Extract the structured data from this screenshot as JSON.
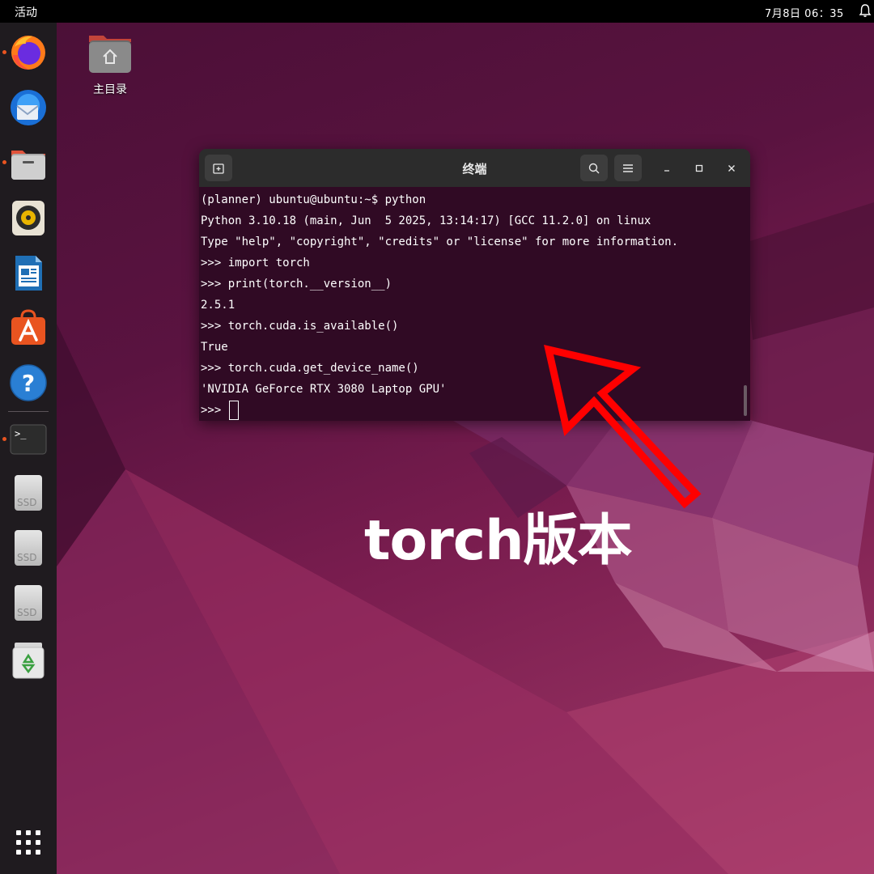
{
  "topbar": {
    "activities": "活动",
    "clock": "7月8日  06：35",
    "notification_icon": "bell-icon"
  },
  "dock": {
    "items": [
      {
        "name": "firefox",
        "icon": "firefox-icon",
        "running": true
      },
      {
        "name": "thunderbird",
        "icon": "thunderbird-icon",
        "running": false
      },
      {
        "name": "files",
        "icon": "files-icon",
        "running": true
      },
      {
        "name": "rhythmbox",
        "icon": "rhythmbox-icon",
        "running": false
      },
      {
        "name": "libreoffice-writer",
        "icon": "writer-icon",
        "running": false
      },
      {
        "name": "app-center",
        "icon": "app-center-icon",
        "running": false
      },
      {
        "name": "help",
        "icon": "help-icon",
        "running": false
      },
      {
        "name": "terminal",
        "icon": "terminal-icon",
        "running": true
      }
    ],
    "drives": [
      "SSD",
      "SSD",
      "SSD"
    ],
    "trash_icon": "trash-icon",
    "show_apps_icon": "app-grid-icon"
  },
  "desktop": {
    "home_label": "主目录"
  },
  "terminal": {
    "title": "终端",
    "lines": [
      "(planner) ubuntu@ubuntu:~$ python",
      "Python 3.10.18 (main, Jun  5 2025, 13:14:17) [GCC 11.2.0] on linux",
      "Type \"help\", \"copyright\", \"credits\" or \"license\" for more information.",
      ">>> import torch",
      ">>> print(torch.__version__)",
      "2.5.1",
      ">>> torch.cuda.is_available()",
      "True",
      ">>> torch.cuda.get_device_name()",
      "'NVIDIA GeForce RTX 3080 Laptop GPU'"
    ],
    "prompt": ">>> "
  },
  "annotation": {
    "caption": "torch版本",
    "arrow_color": "#ff0000"
  },
  "colors": {
    "terminal_bg": "#300a24",
    "header_bg": "#2c2c2c",
    "accent": "#e95420"
  }
}
